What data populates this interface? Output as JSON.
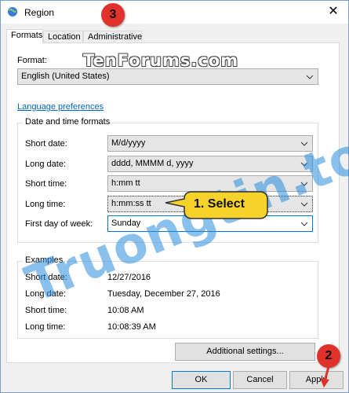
{
  "window": {
    "title": "Region",
    "close_glyph": "✕"
  },
  "tabs": [
    {
      "label": "Formats"
    },
    {
      "label": "Location"
    },
    {
      "label": "Administrative"
    }
  ],
  "format": {
    "label": "Format:",
    "value": "English (United States)"
  },
  "language_link": "Language preferences",
  "datetime_group": {
    "title": "Date and time formats",
    "rows": [
      {
        "label": "Short date:",
        "value": "M/d/yyyy"
      },
      {
        "label": "Long date:",
        "value": "dddd, MMMM d, yyyy"
      },
      {
        "label": "Short time:",
        "value": "h:mm tt"
      },
      {
        "label": "Long time:",
        "value": "h:mm:ss tt"
      },
      {
        "label": "First day of week:",
        "value": "Sunday"
      }
    ]
  },
  "examples_group": {
    "title": "Examples",
    "rows": [
      {
        "label": "Short date:",
        "value": "12/27/2016"
      },
      {
        "label": "Long date:",
        "value": "Tuesday, December 27, 2016"
      },
      {
        "label": "Short time:",
        "value": "10:08 AM"
      },
      {
        "label": "Long time:",
        "value": "10:08:39 AM"
      }
    ]
  },
  "buttons": {
    "additional": "Additional settings...",
    "ok": "OK",
    "cancel": "Cancel",
    "apply": "Apply"
  },
  "annotations": {
    "callout_text": "1. Select",
    "badge_2": "2",
    "badge_3": "3"
  },
  "watermarks": {
    "top": "TenForums.com",
    "diagonal": "Truongtin.top"
  },
  "colors": {
    "callout_fill": "#f6d32a",
    "badge_fill": "#e0312b",
    "link": "#0066cc",
    "focus_border": "#0078d7"
  }
}
